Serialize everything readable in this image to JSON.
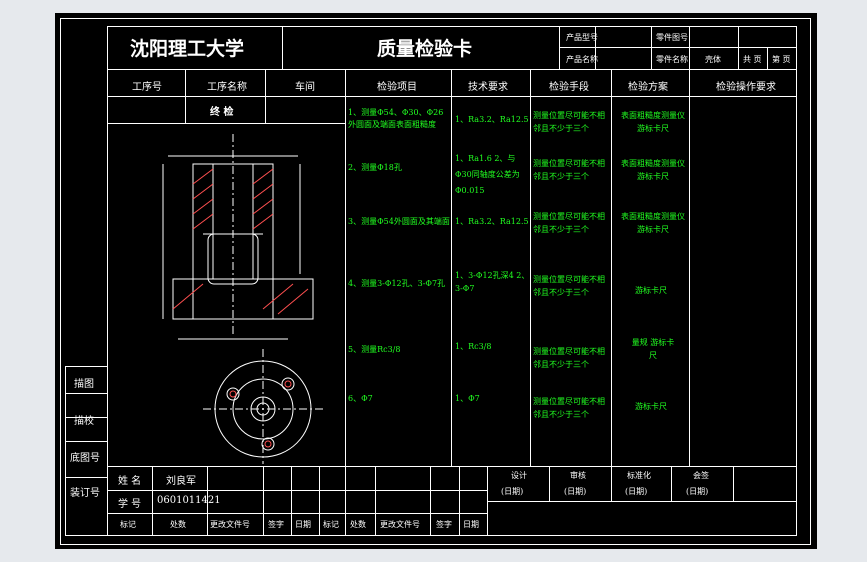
{
  "header": {
    "school": "沈阳理工大学",
    "title": "质量检验卡",
    "product_model_label": "产品型号",
    "part_drawing_no_label": "零件图号",
    "product_name_label": "产品名称",
    "part_name_label": "零件名称",
    "part_name_value": "壳体",
    "total_pages": "共 页",
    "page_no": "第 页"
  },
  "columns": [
    "工序号",
    "工序名称",
    "车间",
    "检验项目",
    "技术要求",
    "检验手段",
    "检验方案",
    "检验操作要求"
  ],
  "process_name": "终 检",
  "rows": [
    {
      "item": "1、测量Φ54、Φ30、Φ26外圆面及端面表面粗糙度",
      "tech": "1、Ra3.2、Ra12.5",
      "means": "测量位置尽可能不相邻且不少于三个",
      "plan": "表面粗糙度测量仪 游标卡尺"
    },
    {
      "item": "2、测量Φ18孔",
      "tech": "1、Ra1.6 2、与Φ30同轴度公差为Φ0.015",
      "means": "测量位置尽可能不相邻且不少于三个",
      "plan": "表面粗糙度测量仪 游标卡尺"
    },
    {
      "item": "3、测量Φ54外圆面及其端面",
      "tech": "1、Ra3.2、Ra12.5",
      "means": "测量位置尽可能不相邻且不少于三个",
      "plan": "表面粗糙度测量仪 游标卡尺"
    },
    {
      "item": "4、测量3-Φ12孔、3-Φ7孔",
      "tech": "1、3-Φ12孔深4 2、3-Φ7",
      "means": "测量位置尽可能不相邻且不少于三个",
      "plan": "游标卡尺"
    },
    {
      "item": "5、测量Rc3/8",
      "tech": "1、Rc3/8",
      "means": "测量位置尽可能不相邻且不少于三个",
      "plan": "量规 游标卡尺"
    },
    {
      "item": "6、Φ7",
      "tech": "1、Φ7",
      "means": "测量位置尽可能不相邻且不少于三个",
      "plan": "游标卡尺"
    }
  ],
  "side_labels": [
    "描图",
    "描校",
    "底图号",
    "装订号"
  ],
  "footer": {
    "name_label": "姓 名",
    "name_value": "刘良军",
    "id_label": "学 号",
    "id_value": "0601011421",
    "rev_headers": [
      "标记",
      "处数",
      "更改文件号",
      "签字",
      "日期",
      "标记",
      "处数",
      "更改文件号",
      "签字",
      "日期"
    ],
    "sign": [
      {
        "label": "设计",
        "date": "(日期)"
      },
      {
        "label": "审核",
        "date": "(日期)"
      },
      {
        "label": "标准化",
        "date": "(日期)"
      },
      {
        "label": "会签",
        "date": "(日期)"
      }
    ]
  }
}
